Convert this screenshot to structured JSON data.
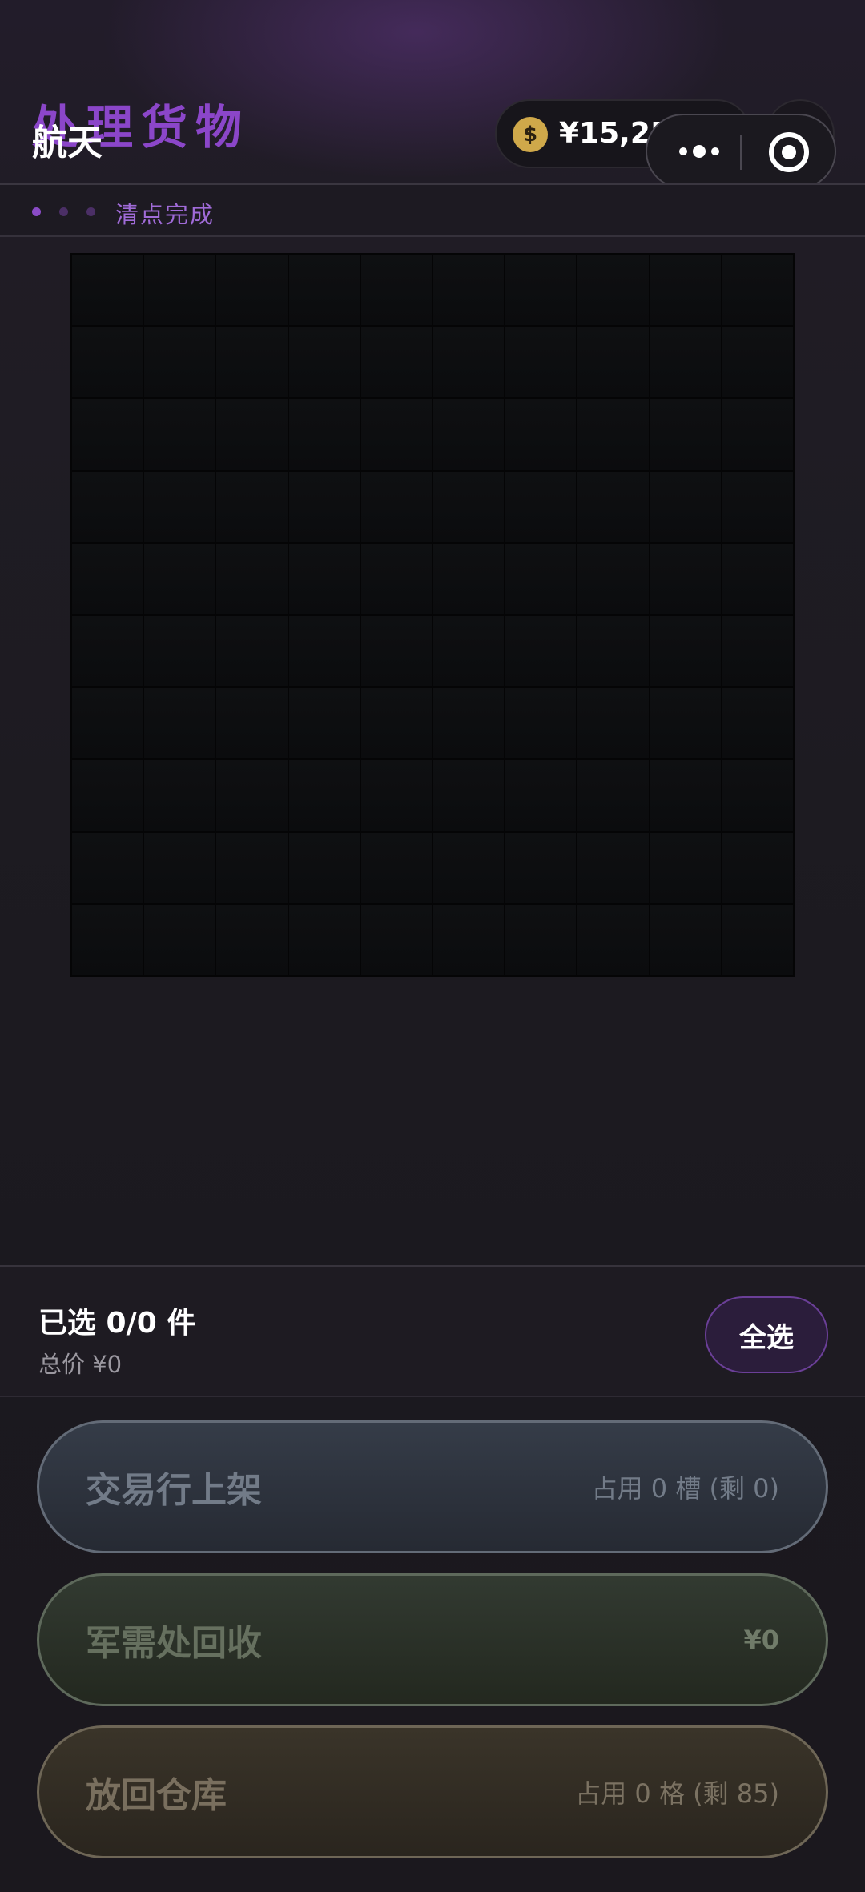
{
  "header": {
    "page_title": "处理货物",
    "app_name": "航天",
    "currency_value": "¥15,250,265",
    "coin_icon": "dollar-coin-icon",
    "coin_symbol": "$",
    "add_icon": "plus-icon",
    "add_symbol": "+",
    "more_icon": "more-dots-icon",
    "close_icon": "record-circle-icon"
  },
  "progress": {
    "steps": 3,
    "active_step": 1,
    "label": "清点完成",
    "active_color": "#8a4bc6",
    "inactive_color": "#4b2f66"
  },
  "grid": {
    "rows": 10,
    "cols": 10,
    "items": []
  },
  "selection": {
    "count_text": "已选 0/0 件",
    "price_text": "总价  ¥0",
    "select_all_label": "全选"
  },
  "actions": {
    "trade": {
      "label": "交易行上架",
      "info": "占用 0 槽 (剩 0)"
    },
    "recycle": {
      "label": "军需处回收",
      "info": "¥0"
    },
    "store": {
      "label": "放回仓库",
      "info": "占用 0 格 (剩 85)"
    }
  },
  "colors": {
    "accent_purple": "#8b46c9",
    "coin_gold": "#cfa84a",
    "background": "#1d1a21"
  }
}
